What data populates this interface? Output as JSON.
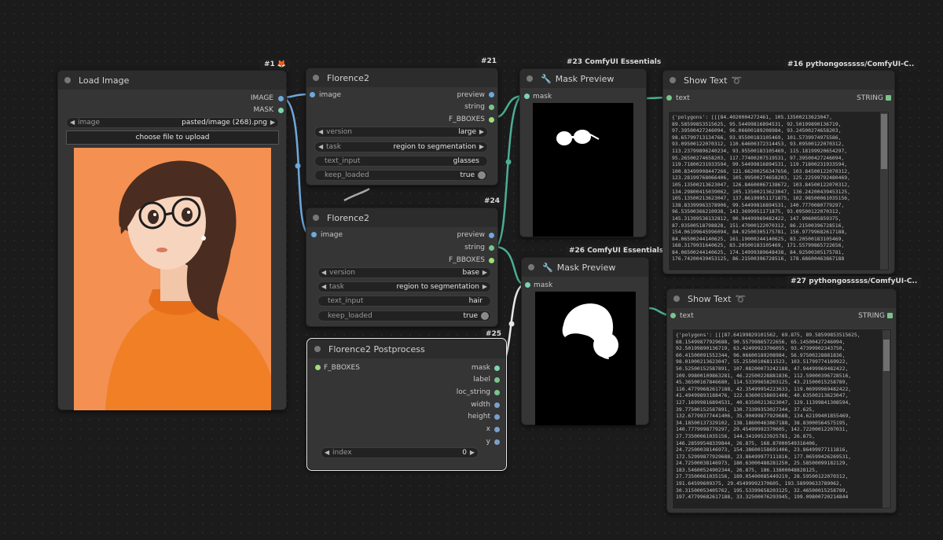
{
  "colors": {
    "image": "#6fa8dc",
    "mask": "#7fd4b0",
    "string": "#79c48a",
    "bbox": "#9ede7a",
    "int": "#7b9fc9",
    "link_green": "#4cae94",
    "link_white": "#e8e8e8",
    "link_blue": "#6fa8dc"
  },
  "nodes": {
    "load_image": {
      "badge": "#1 🦊",
      "title": "Load Image",
      "outputs": [
        "IMAGE",
        "MASK"
      ],
      "image_widget": {
        "name": "image",
        "value": "pasted/image (268).png"
      },
      "upload_label": "choose file to upload"
    },
    "florence_a": {
      "badge": "#21",
      "title": "Florence2",
      "input": "image",
      "outputs": [
        "preview",
        "string",
        "F_BBOXES"
      ],
      "widgets": {
        "version": "large",
        "task": "region to segmentation",
        "text_input": "glasses",
        "keep_loaded": "true"
      },
      "labels": {
        "version": "version",
        "task": "task",
        "text_input": "text_input",
        "keep_loaded": "keep_loaded"
      }
    },
    "florence_b": {
      "badge": "#24",
      "title": "Florence2",
      "input": "image",
      "outputs": [
        "preview",
        "string",
        "F_BBOXES"
      ],
      "widgets": {
        "version": "base",
        "task": "region to segmentation",
        "text_input": "hair",
        "keep_loaded": "true"
      },
      "labels": {
        "version": "version",
        "task": "task",
        "text_input": "text_input",
        "keep_loaded": "keep_loaded"
      }
    },
    "postprocess": {
      "badge": "#25",
      "title": "Florence2 Postprocess",
      "input": "F_BBOXES",
      "outputs": [
        "mask",
        "label",
        "loc_string",
        "width",
        "height",
        "x",
        "y"
      ],
      "widget": {
        "name": "index",
        "value": "0"
      }
    },
    "mask_a": {
      "badge": "#23 ComfyUI Essentials",
      "title": "Mask Preview",
      "input": "mask"
    },
    "mask_b": {
      "badge": "#26 ComfyUI Essentials",
      "title": "Mask Preview",
      "input": "mask"
    },
    "text_a": {
      "badge": "#16 pythongosssss/ComfyUI-C..",
      "title": "Show Text",
      "input": "text",
      "output": "STRING",
      "lines": [
        "{'polygons': [[[84.4020004272461, 105.13500213623047,",
        "89.58599853515625, 95.54499816894531, 92.50199890136719,",
        "97.39500427246094, 96.06600189208984, 93.24500274658203,",
        "98.65799713134766, 93.95500183105469, 101.5739974975586,",
        "93.09500122070312, 110.64600372314453, 93.09500122070312,",
        "113.23799896240234, 93.95500183105469, 115.18199920654297,",
        "95.26500274658203, 117.77400207519531, 97.39500427246094,",
        "119.71800231933594, 99.54499816894531, 119.71800231933594,",
        "100.83499908447266, 121.66200256347656, 103.84500122070312,",
        "123.28199768066406, 105.99500274658203, 125.22599792480469,",
        "105.13500213623047, 126.84600067138672, 103.84500122070312,",
        "134.29800415039062, 105.13500213623047, 136.24200439453125,",
        "105.13500213623047, 137.86199951171875, 102.98500061035156,",
        "138.83399963378906, 99.54499816894531, 140.7770080779297,",
        "96.53500366210938, 143.3699951171875, 93.09500122070312,",
        "145.31399536132812, 90.94499969482422, 147.906005859375,",
        "87.93500518798828, 151.47000122070312, 86.21500396728516,",
        "154.06199645996094, 84.92500305175781, 156.97799682617188,",
        "84.06500244140625, 161.19000244140625, 83.20500183105469,",
        "168.3179931640625, 83.20500183105469, 171.55799865722656,",
        "84.06500244140625, 174.14999389648438, 84.92500305175781,",
        "176.74200439453125, 86.21500396728516, 178.68600463867188"
      ]
    },
    "text_b": {
      "badge": "#27 pythongosssss/ComfyUI-C..",
      "title": "Show Text",
      "input": "text",
      "output": "STRING",
      "lines": [
        "{'polygons': [[[87.64199829101562, 69.875, 89.58599853515625,",
        "68.15499877929688, 90.55799865722656, 65.14500427246094,",
        "92.50199890136719, 63.42499923706055, 93.47399902343750,",
        "60.41500091552344, 96.06600189208984, 56.97500228881836,",
        "98.01000213623047, 55.25500106811523, 103.51799774169922,",
        "50.52500152587891, 107.08200073242188, 47.94499969482422,",
        "109.99800109863281, 46.22500228881836, 112.59000396728516,",
        "45.36500167846680, 114.53399658203125, 43.21500015258789,",
        "116.47799682617188, 42.35499954223633, 119.06999969482422,",
        "41.49499893188476, 122.63600158691406, 40.63500213623047,",
        "127.16999816894531, 40.63500213623047, 129.11399841308594,",
        "39.77500152587891, 130.73399353027344, 37.625,",
        "132.67799377441406, 35.90499877929688, 134.62199401855469,",
        "34.18500137329102, 138.18600463867188, 38.83000564575195,",
        "140.7779998779297, 29.45499992370605, 142.72200012207031,",
        "27.73500061035156, 144.34199523925781, 26.875,",
        "146.28599548339844, 26.875, 168.87000549316406,",
        "24.72500038146973, 154.38600158691406, 23.86499977111816,",
        "172.52999877929688, 23.86499977111816, 177.06599426269531,",
        "24.72500038146973, 180.63000488281250, 25.58500099182129,",
        "183.54600524902344, 26.875, 186.13800048828125,",
        "27.73500061035156, 189.05400085449219, 28.59500122070312,",
        "191.64599609375, 29.45499992370605, 193.58999633789062,",
        "30.31500053405762, 195.53399658203125, 32.46500015258789,",
        "197.47799682617188, 33.32500076293945, 199.09800720214844"
      ]
    }
  }
}
